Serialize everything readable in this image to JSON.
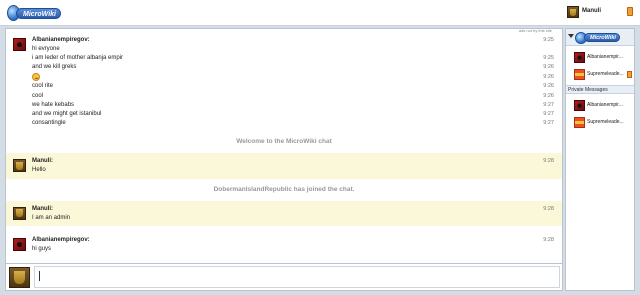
{
  "header": {
    "logo_text": "MicroWiki",
    "current_user": "Manuli"
  },
  "main": {
    "ads_note": "ads not by this site",
    "messages": [
      {
        "type": "message",
        "author": "Albanianempiregov:",
        "avatar": "red-emblem-avatar",
        "highlight": false,
        "lines": [
          {
            "text": "hi evryone",
            "time": "9:25"
          },
          {
            "text": "i am leder of mother albanja empir",
            "time": "9:25"
          },
          {
            "text": "and we kill greks",
            "time": "9:26"
          },
          {
            "text": "",
            "emoji": "smiley",
            "time": "9:26"
          },
          {
            "text": "cool rite",
            "time": "9:26"
          },
          {
            "text": "cool",
            "time": "9:26"
          },
          {
            "text": "we hate kebabs",
            "time": "9:27"
          },
          {
            "text": "and we might get istanibul",
            "time": "9:27"
          },
          {
            "text": "consantingle",
            "time": "9:27"
          }
        ]
      },
      {
        "type": "notice",
        "text": "Welcome to the MicroWiki chat"
      },
      {
        "type": "message",
        "author": "Manuli:",
        "avatar": "crest-avatar",
        "highlight": true,
        "lines": [
          {
            "text": "Hello",
            "time": "9:28"
          }
        ]
      },
      {
        "type": "notice",
        "text": "DobermanIslandRepublic has joined the chat."
      },
      {
        "type": "message",
        "author": "Manuli:",
        "avatar": "crest-avatar",
        "highlight": true,
        "lines": [
          {
            "text": "I am an admin",
            "time": "9:28"
          }
        ]
      },
      {
        "type": "message",
        "author": "Albanianempiregov:",
        "avatar": "red-emblem-avatar",
        "highlight": false,
        "lines": [
          {
            "text": "hi guys",
            "time": "9:28"
          }
        ]
      }
    ],
    "input": {
      "value": "",
      "placeholder": ""
    }
  },
  "sidebar": {
    "room_logo_text": "MicroWiki",
    "users": [
      {
        "name": "Albanianempir...",
        "avatar": "red-emblem-avatar",
        "badge": false
      },
      {
        "name": "Supremeleade...",
        "avatar": "flag-avatar",
        "badge": true
      }
    ],
    "private_title": "Private Messages",
    "private_users": [
      {
        "name": "Albanianempir...",
        "avatar": "red-emblem-avatar"
      },
      {
        "name": "Supremeleade...",
        "avatar": "flag-avatar"
      }
    ]
  }
}
